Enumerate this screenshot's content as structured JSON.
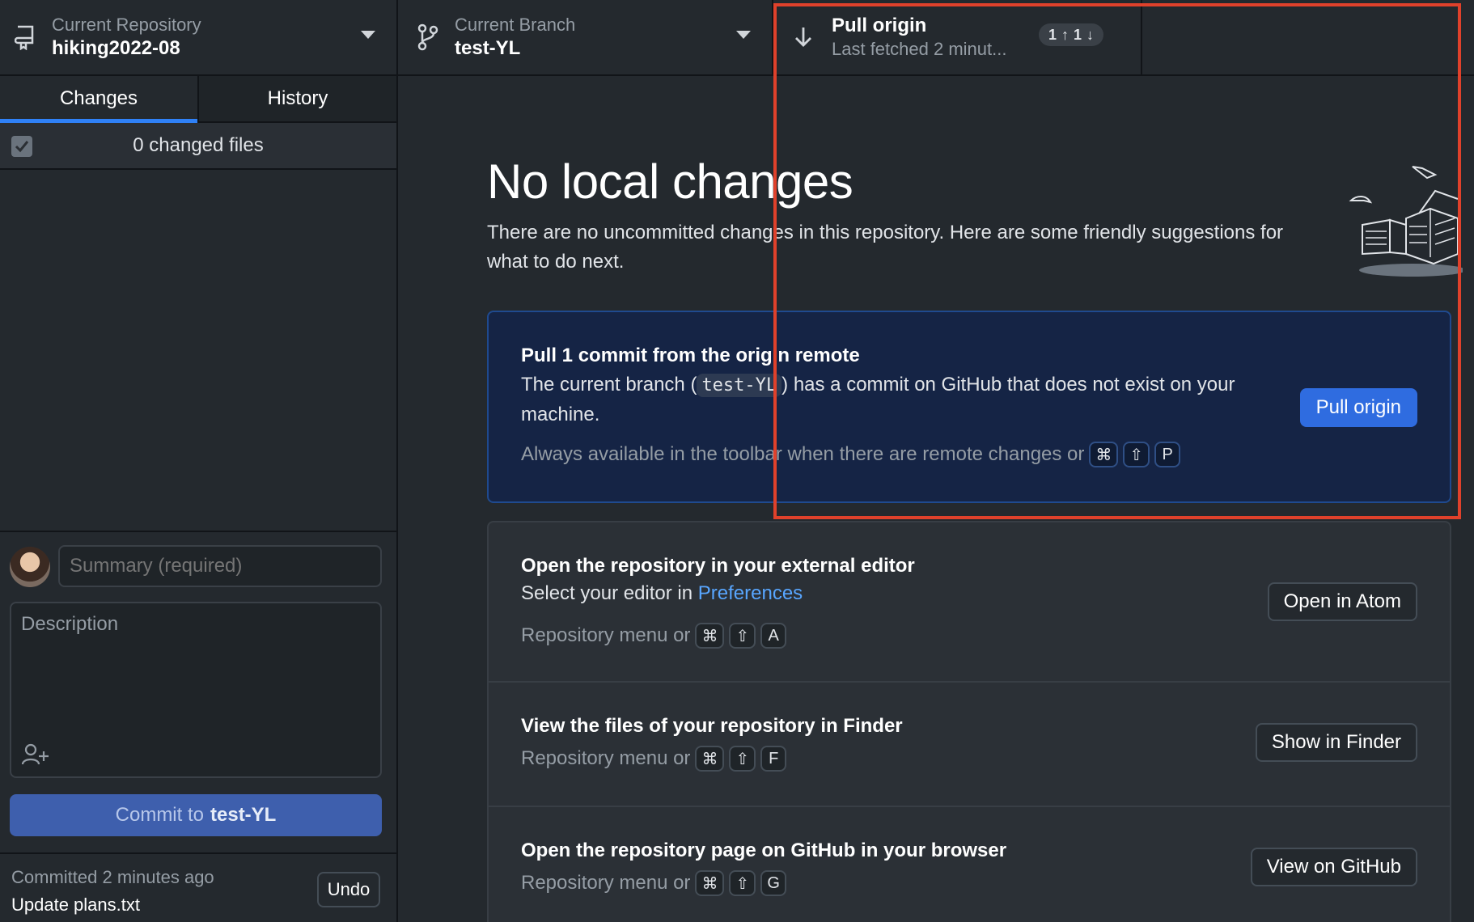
{
  "toolbar": {
    "repository": {
      "label": "Current Repository",
      "value": "hiking2022-08",
      "icon": "repo-icon"
    },
    "branch": {
      "label": "Current Branch",
      "value": "test-YL",
      "icon": "git-branch-icon"
    },
    "pull": {
      "title": "Pull origin",
      "subtitle": "Last fetched 2 minut...",
      "ahead": "1",
      "behind": "1",
      "icon": "arrow-down-icon"
    }
  },
  "sidebar": {
    "tabs": [
      {
        "label": "Changes",
        "active": true
      },
      {
        "label": "History",
        "active": false
      }
    ],
    "changed_files": "0 changed files",
    "commit": {
      "summary_placeholder": "Summary (required)",
      "description_placeholder": "Description",
      "button_prefix": "Commit to",
      "button_branch": "test-YL"
    },
    "last_commit": {
      "label": "Committed 2 minutes ago",
      "message": "Update plans.txt",
      "undo_label": "Undo"
    }
  },
  "main": {
    "title": "No local changes",
    "description": "There are no uncommitted changes in this repository. Here are some friendly suggestions for what to do next.",
    "pull_card": {
      "title": "Pull 1 commit from the origin remote",
      "text_before": "The current branch (",
      "branch": "test-YL",
      "text_after": ") has a commit on GitHub that does not exist on your machine.",
      "hint": "Always available in the toolbar when there are remote changes or",
      "keys": [
        "⌘",
        "⇧",
        "P"
      ],
      "button": "Pull origin"
    },
    "atom_card": {
      "title": "Open the repository in your external editor",
      "text": "Select your editor in",
      "link": "Preferences",
      "hint": "Repository menu or",
      "keys": [
        "⌘",
        "⇧",
        "A"
      ],
      "button": "Open in Atom"
    },
    "finder_card": {
      "title": "View the files of your repository in Finder",
      "hint": "Repository menu or",
      "keys": [
        "⌘",
        "⇧",
        "F"
      ],
      "button": "Show in Finder"
    },
    "github_card": {
      "title": "Open the repository page on GitHub in your browser",
      "hint": "Repository menu or",
      "keys": [
        "⌘",
        "⇧",
        "G"
      ],
      "button": "View on GitHub"
    }
  },
  "colors": {
    "accent": "#2f6ce0",
    "highlight": "#e0412b",
    "background": "#24292e"
  }
}
